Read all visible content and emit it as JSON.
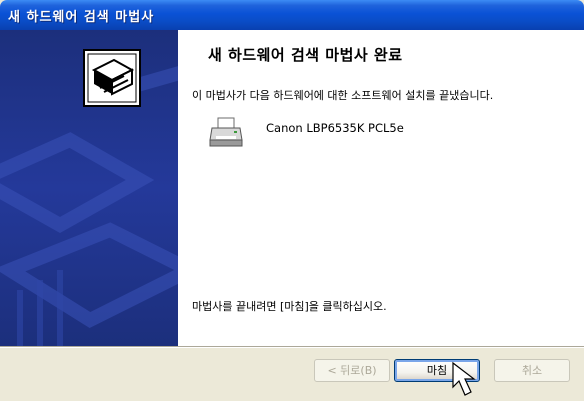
{
  "window": {
    "title": "새 하드웨어 검색 마법사"
  },
  "content": {
    "heading": "새 하드웨어 검색 마법사 완료",
    "description": "이 마법사가 다음 하드웨어에 대한 소프트웨어 설치를 끝냈습니다.",
    "device": {
      "icon": "printer-icon",
      "name": "Canon LBP6535K PCL5e"
    },
    "finish_instruction": "마법사를 끝내려면 [마침]을 클릭하십시오."
  },
  "buttons": {
    "back": "< 뒤로(B)",
    "finish": "마침",
    "cancel": "취소"
  },
  "colors": {
    "titlebar": "#0a52d6",
    "sidebar": "#24399a",
    "dialog_bg": "#ece9d8"
  }
}
